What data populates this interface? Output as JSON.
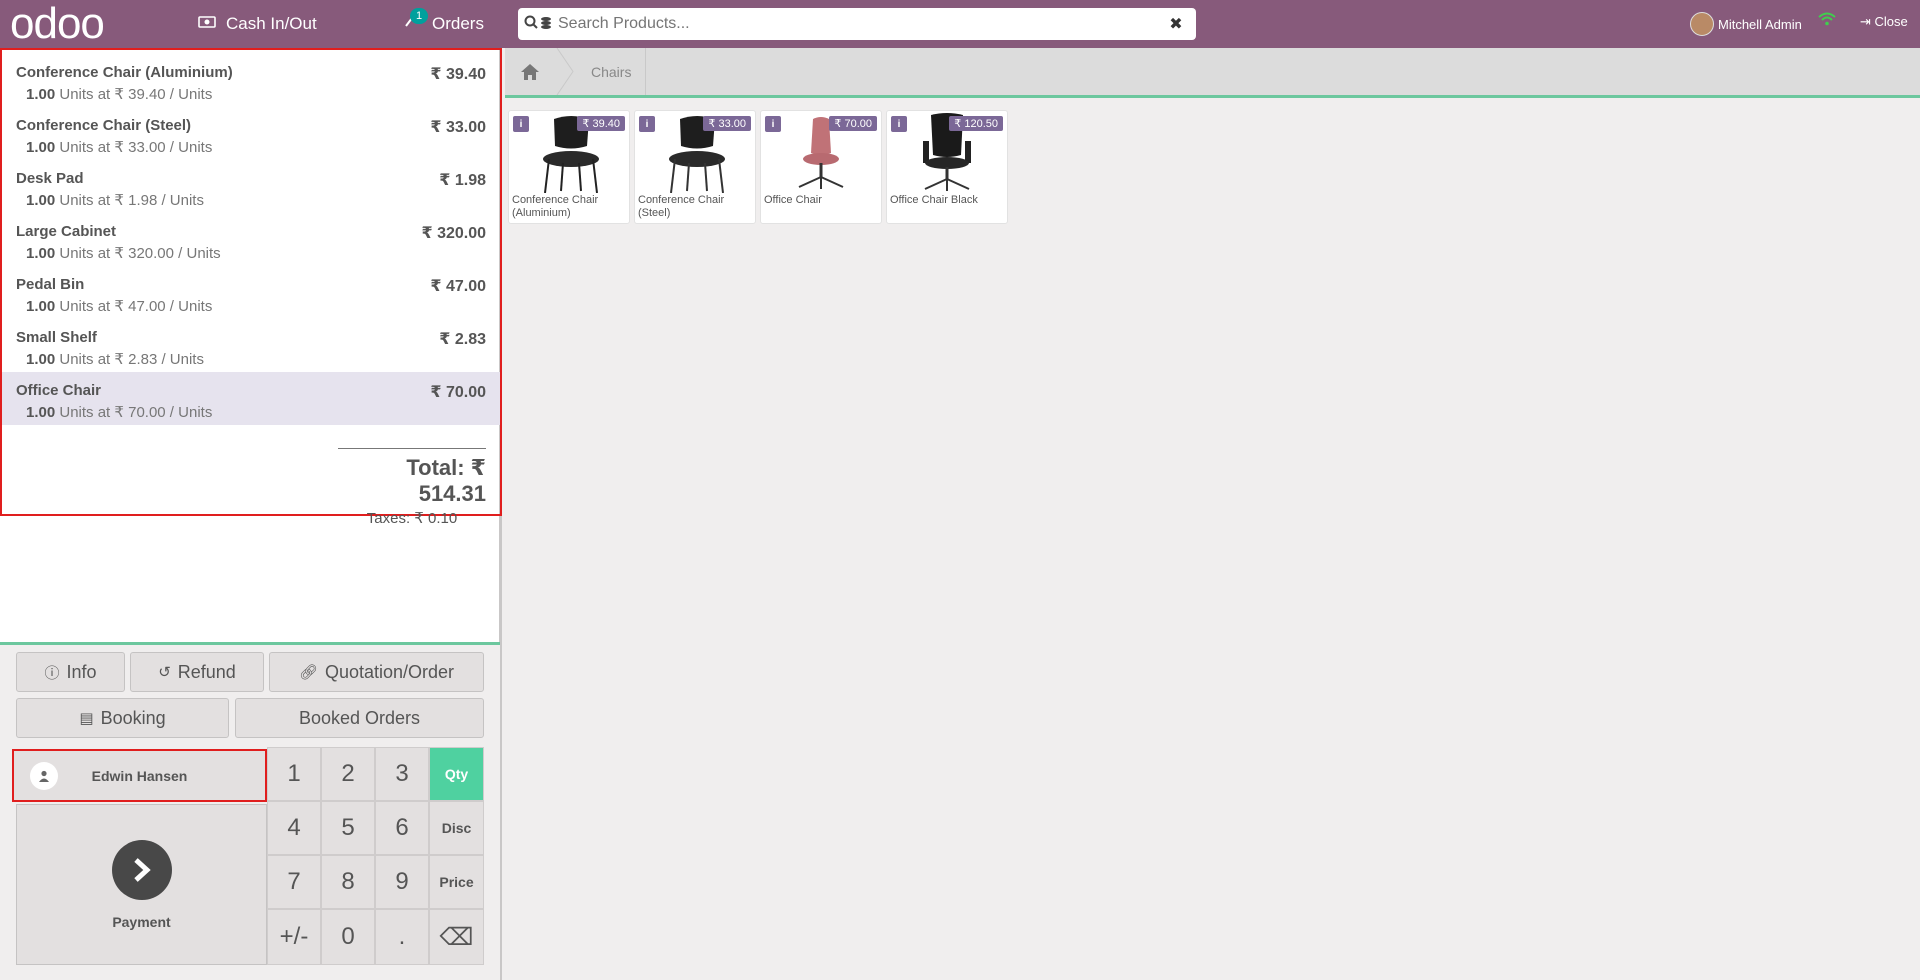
{
  "header": {
    "logo": "odoo",
    "cash_label": "Cash In/Out",
    "orders_label": "Orders",
    "orders_badge": "1",
    "search_placeholder": "Search Products...",
    "user_name": "Mitchell Admin",
    "close_label": "Close"
  },
  "order": {
    "lines": [
      {
        "name": "Conference Chair (Aluminium)",
        "price": "₹ 39.40",
        "qty": "1.00",
        "detail": " Units at ₹ 39.40 / Units"
      },
      {
        "name": "Conference Chair (Steel)",
        "price": "₹ 33.00",
        "qty": "1.00",
        "detail": " Units at ₹ 33.00 / Units"
      },
      {
        "name": "Desk Pad",
        "price": "₹ 1.98",
        "qty": "1.00",
        "detail": " Units at ₹ 1.98 / Units"
      },
      {
        "name": "Large Cabinet",
        "price": "₹ 320.00",
        "qty": "1.00",
        "detail": " Units at ₹ 320.00 / Units"
      },
      {
        "name": "Pedal Bin",
        "price": "₹ 47.00",
        "qty": "1.00",
        "detail": " Units at ₹ 47.00 / Units"
      },
      {
        "name": "Small Shelf",
        "price": "₹ 2.83",
        "qty": "1.00",
        "detail": " Units at ₹ 2.83 / Units"
      },
      {
        "name": "Office Chair",
        "price": "₹ 70.00",
        "qty": "1.00",
        "detail": " Units at ₹ 70.00 / Units"
      }
    ],
    "total": "Total: ₹ 514.31",
    "taxes": "Taxes: ₹ 0.10"
  },
  "controls": {
    "info": "Info",
    "refund": "Refund",
    "quotation": "Quotation/Order",
    "booking": "Booking",
    "booked_orders": "Booked Orders",
    "customer": "Edwin Hansen",
    "payment": "Payment"
  },
  "numpad": {
    "keys": [
      "1",
      "2",
      "3",
      "Qty",
      "4",
      "5",
      "6",
      "Disc",
      "7",
      "8",
      "9",
      "Price",
      "+/-",
      "0",
      ".",
      "⌫"
    ]
  },
  "breadcrumb": {
    "category": "Chairs"
  },
  "products": [
    {
      "name": "Conference Chair (Aluminium)",
      "price": "₹ 39.40"
    },
    {
      "name": "Conference Chair (Steel)",
      "price": "₹ 33.00"
    },
    {
      "name": "Office Chair",
      "price": "₹ 70.00"
    },
    {
      "name": "Office Chair Black",
      "price": "₹ 120.50"
    }
  ],
  "colors": {
    "brand": "#875a7b",
    "accent": "#4fd1a0",
    "tag": "#7b6897"
  }
}
